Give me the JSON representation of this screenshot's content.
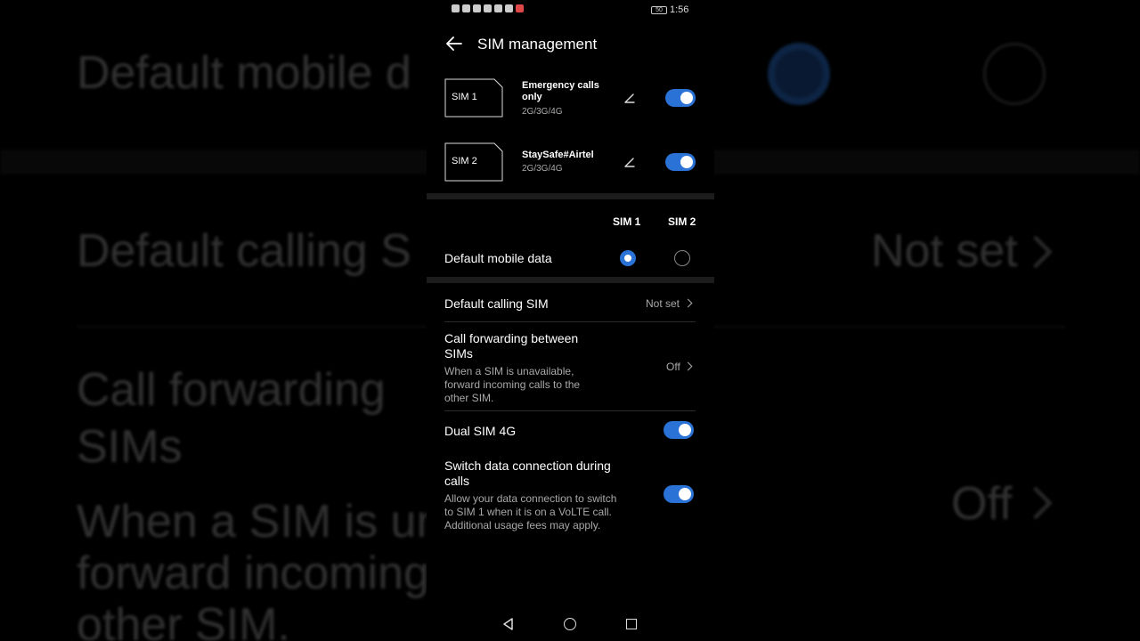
{
  "background": {
    "line1": "Default mobile d",
    "line2": "Default calling S",
    "line2_value": "Not set",
    "line3a": "Call forwarding",
    "line3b": "SIMs",
    "line3_value": "Off",
    "line4": "When a SIM is una",
    "line5": "forward incoming",
    "line6": "other SIM."
  },
  "status_bar": {
    "time": "1:56",
    "battery": "50"
  },
  "header": {
    "title": "SIM management"
  },
  "sims": [
    {
      "card_label": "SIM 1",
      "name": "Emergency calls only",
      "network": "2G/3G/4G",
      "enabled": true
    },
    {
      "card_label": "SIM 2",
      "name": "StaySafe#Airtel",
      "network": "2G/3G/4G",
      "enabled": true
    }
  ],
  "default_data": {
    "col_sim1": "SIM 1",
    "col_sim2": "SIM 2",
    "label": "Default mobile data",
    "selected": "SIM 1"
  },
  "settings": {
    "calling_sim": {
      "label": "Default calling SIM",
      "value": "Not set"
    },
    "call_forwarding": {
      "label": "Call forwarding between SIMs",
      "label_line1": "Call forwarding between",
      "label_line2": "SIMs",
      "desc_line1": "When a SIM is unavailable,",
      "desc_line2": "forward incoming calls to the",
      "desc_line3": "other SIM.",
      "value": "Off"
    },
    "dual_4g": {
      "label": "Dual SIM 4G",
      "enabled": true
    },
    "switch_data": {
      "label_line1": "Switch data connection during",
      "label_line2": "calls",
      "desc_line1": "Allow your data connection to switch",
      "desc_line2": "to SIM 1 when it is on a VoLTE call.",
      "desc_line3": "Additional usage fees may apply.",
      "enabled": true
    }
  },
  "colors": {
    "accent": "#2b72d6",
    "background": "#000000",
    "separator": "#1c1c1c"
  },
  "icons": [
    "back-arrow-icon",
    "pencil-icon",
    "chevron-right-icon",
    "nav-back-icon",
    "nav-home-icon",
    "nav-recent-icon"
  ]
}
